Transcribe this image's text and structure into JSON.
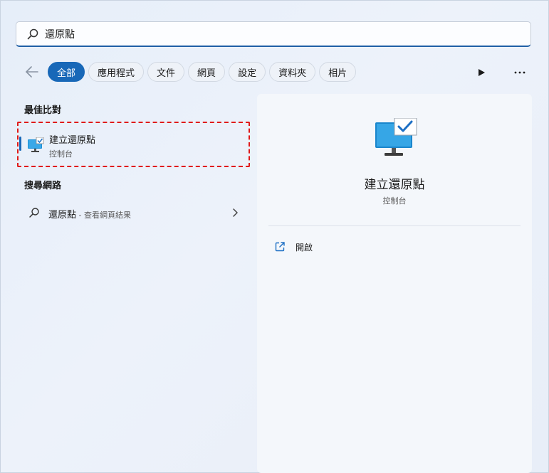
{
  "search": {
    "query": "還原點"
  },
  "filters": {
    "tabs": [
      {
        "label": "全部",
        "active": true
      },
      {
        "label": "應用程式"
      },
      {
        "label": "文件"
      },
      {
        "label": "網頁"
      },
      {
        "label": "設定"
      },
      {
        "label": "資料夾"
      },
      {
        "label": "相片"
      }
    ]
  },
  "best_match": {
    "heading": "最佳比對",
    "item": {
      "title": "建立還原點",
      "subtitle": "控制台",
      "icon": "monitor-check-icon"
    }
  },
  "web_search": {
    "heading": "搜尋網路",
    "item": {
      "query": "還原點",
      "suffix": " - 查看網頁結果"
    }
  },
  "preview": {
    "title": "建立還原點",
    "subtitle": "控制台",
    "action": {
      "label": "開啟",
      "icon": "open-external-icon"
    }
  },
  "colors": {
    "accent": "#1868b8",
    "highlight_border": "#e01a1a"
  }
}
